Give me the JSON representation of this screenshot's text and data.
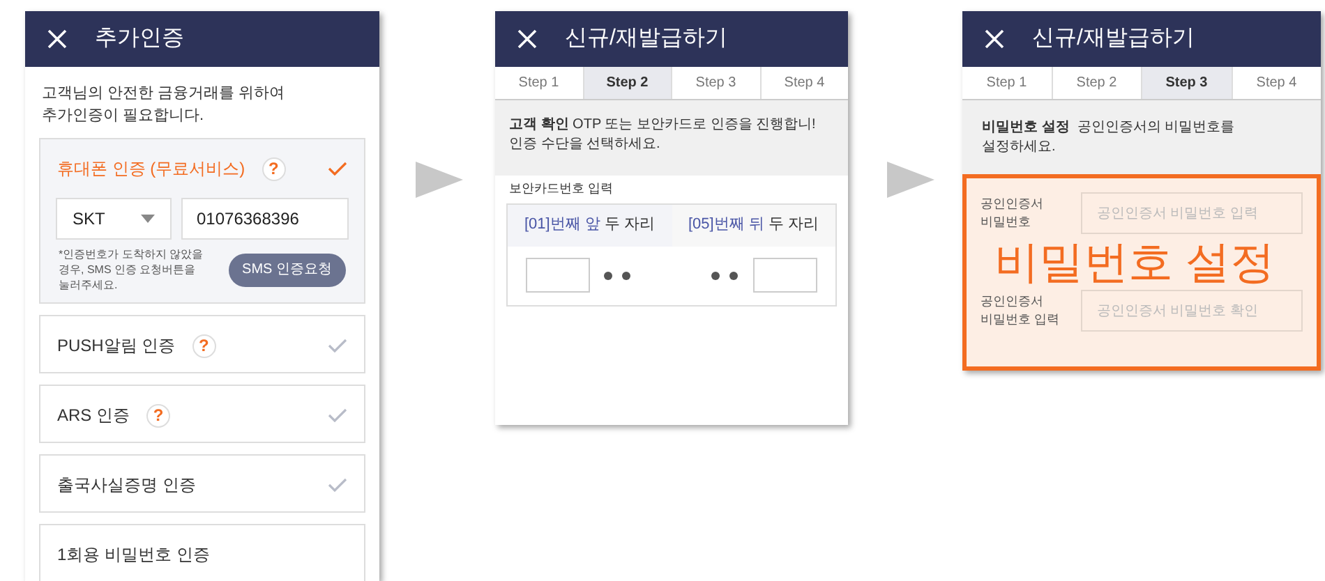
{
  "auth_screen": {
    "title": "추가인증",
    "intro": "고객님의 안전한 금융거래를 위하여 추가인증이 필요합니다.",
    "methods": [
      {
        "label": "휴대폰 인증 (무료서비스)",
        "help": "?",
        "selected": true,
        "checkmark": true
      },
      {
        "label": "PUSH알림 인증",
        "help": "?",
        "selected": false,
        "checkmark": true
      },
      {
        "label": "ARS 인증",
        "help": "?",
        "selected": false,
        "checkmark": true
      },
      {
        "label": "출국사실증명 인증",
        "selected": false,
        "checkmark": true
      },
      {
        "label": "1회용 비밀번호 인증",
        "selected": false,
        "checkmark": false
      }
    ],
    "carrier": "SKT",
    "phone": "01076368396",
    "note": "*인증번호가 도착하지 않았을 경우, SMS 인증 요청버튼을 눌러주세요.",
    "sms_button": "SMS 인증요청"
  },
  "card_screen": {
    "title": "신규/재발급하기",
    "steps": [
      {
        "label": "Step 1",
        "selected": false
      },
      {
        "label": "Step 2",
        "selected": true
      },
      {
        "label": "Step 3",
        "selected": false
      },
      {
        "label": "Step 4",
        "selected": false
      }
    ],
    "intro": "**고객 확인** OTP 또는 보안카드로 인증을 진행합니! 인증 수단을 선택하세요.",
    "card_label": "보안카드번호 입력",
    "columns": [
      {
        "index": "[01]번째 앞",
        "rest": "두 자리"
      },
      {
        "index": "[05]번째 뒤",
        "rest": "두 자리"
      }
    ]
  },
  "password_screen": {
    "title": "신규/재발급하기",
    "steps": [
      {
        "label": "Step 1",
        "selected": false
      },
      {
        "label": "Step 2",
        "selected": false
      },
      {
        "label": "Step 3",
        "selected": true
      },
      {
        "label": "Step 4",
        "selected": false
      }
    ],
    "intro": "**비밀번호 설정**  공인인증서의 비밀번호를 설정하세요.",
    "fields": [
      {
        "label": "공인인증서 비밀번호",
        "placeholder": "공인인증서 비밀번호 입력"
      },
      {
        "label": "공인인증서 비밀번호 입력",
        "placeholder": "공인인증서 비밀번호 확인"
      }
    ],
    "overlay": "비밀번호 설정"
  }
}
